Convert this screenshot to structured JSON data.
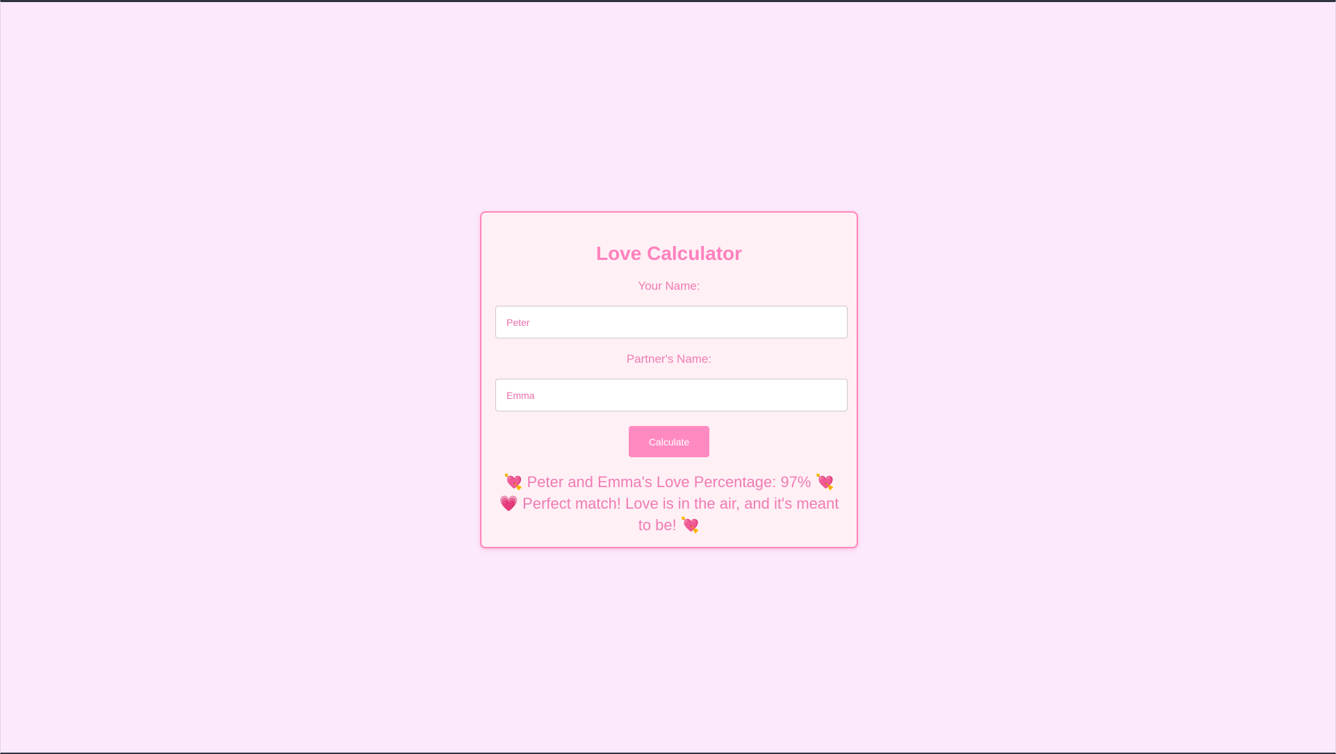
{
  "app": {
    "title": "Love Calculator"
  },
  "form": {
    "your_name_label": "Your Name:",
    "your_name_value": "Peter",
    "partner_name_label": "Partner's Name:",
    "partner_name_value": "Emma",
    "calculate_label": "Calculate"
  },
  "result": {
    "emoji_arrow": "💘",
    "emoji_sparkle": "💗",
    "percentage_text": "Peter and Emma's Love Percentage: 97%",
    "message_text": "Perfect match! Love is in the air, and it's meant to be!"
  },
  "colors": {
    "page_background": "#fce9fb",
    "card_background": "#fff0f5",
    "accent": "#ff80bd",
    "button": "#ff8ac1"
  }
}
